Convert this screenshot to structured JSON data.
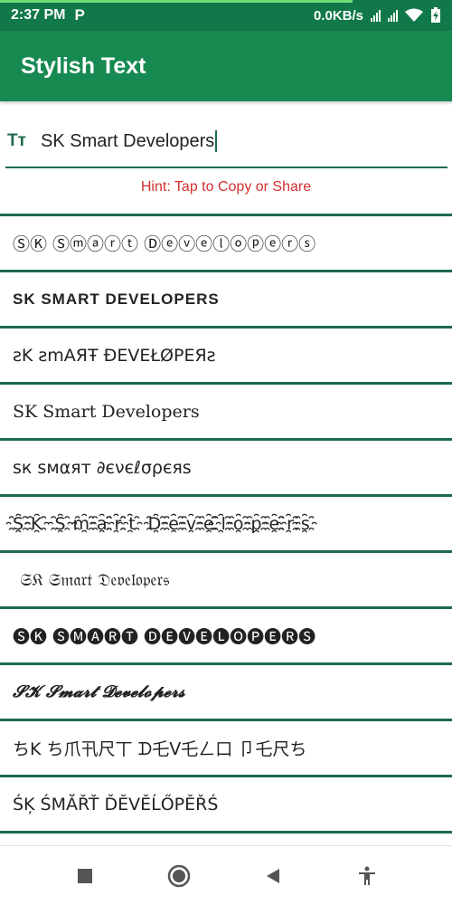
{
  "status": {
    "time": "2:37 PM",
    "app_icon": "P",
    "net_speed": "0.0KB/s",
    "download_progress": 0.78
  },
  "app_bar": {
    "title": "Stylish Text"
  },
  "input": {
    "icon_label": "Tт",
    "value": "SK Smart Developers"
  },
  "hint": "Hint: Tap to Copy or Share",
  "styles": [
    {
      "text": "ⓈⓀ Ⓢⓜⓐⓡⓣ Ⓓⓔⓥⓔⓛⓞⓟⓔⓡⓢ",
      "cls": ""
    },
    {
      "text": "SK SMART DEVELOPERS",
      "cls": "wide"
    },
    {
      "text": "ƨK ƨmAЯŦ ĐEVEŁØPEЯƨ",
      "cls": ""
    },
    {
      "text": "SK Smart Developers",
      "cls": "serif"
    },
    {
      "text": "ѕк ѕмαят ∂єνєℓσρєяѕ",
      "cls": ""
    },
    {
      "text": "S҈K҈ S҈m҈a҈r҈t҈ D҈e҈v҈e҈l҈o҈p҈e҈r҈s҈",
      "cls": ""
    },
    {
      "text": "𝔖𝔎 𝔖𝔪𝔞𝔯𝔱 𝔇𝔢𝔳𝔢𝔩𝔬𝔭𝔢𝔯𝔰",
      "cls": "pad"
    },
    {
      "text": "🅢🅚 🅢🅜🅐🅡🅣 🅓🅔🅥🅔🅛🅞🅟🅔🅡🅢",
      "cls": ""
    },
    {
      "text": "𝓢𝓚 𝓢𝓶𝓪𝓻𝓽 𝓓𝓮𝓿𝓮𝓵𝓸𝓹𝓮𝓻𝓼",
      "cls": "italic-serif"
    },
    {
      "text": "ち𝖪 ち爪卂尺丅 ᗪ乇ᐯ乇ㄥ口 卩乇尺ち",
      "cls": ""
    },
    {
      "text": "ŚĶ ŚMĂŘŤ ĎĚVĚĹŐPĚŘŚ",
      "cls": ""
    }
  ],
  "colors": {
    "status_bar": "#11784a",
    "app_bar": "#178a52",
    "divider": "#1d6b4a",
    "hint": "#d32f2f"
  },
  "nav": [
    "recents-button",
    "home-button",
    "back-button",
    "accessibility-button"
  ]
}
